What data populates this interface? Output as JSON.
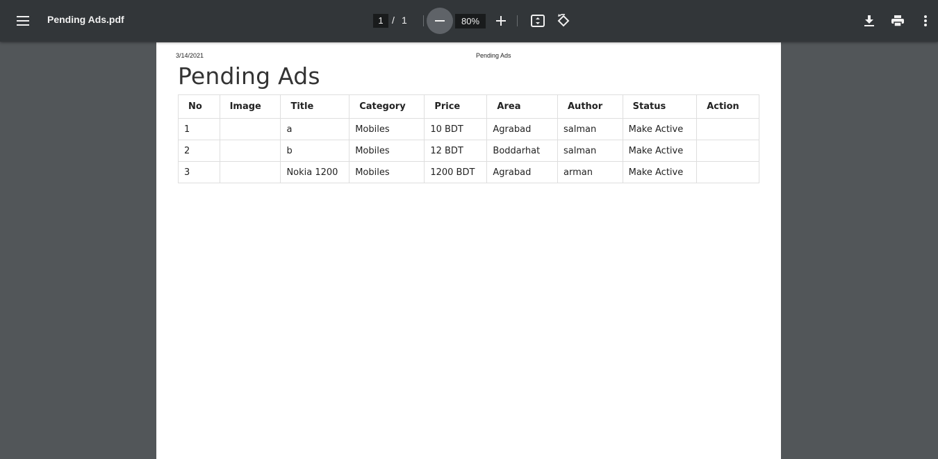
{
  "toolbar": {
    "file_name": "Pending Ads.pdf",
    "current_page": "1",
    "page_separator": "/",
    "total_pages": "1",
    "zoom": "80%",
    "icons": [
      "menu-icon",
      "zoom-out-icon",
      "zoom-in-icon",
      "fit-page-icon",
      "rotate-icon",
      "download-icon",
      "print-icon",
      "more-vert-icon"
    ]
  },
  "document": {
    "header_date": "3/14/2021",
    "header_title": "Pending Ads",
    "title": "Pending Ads",
    "table": {
      "headers": [
        "No",
        "Image",
        "Title",
        "Category",
        "Price",
        "Area",
        "Author",
        "Status",
        "Action"
      ],
      "rows": [
        [
          "1",
          "",
          "a",
          "Mobiles",
          "10 BDT",
          "Agrabad",
          "salman",
          "Make Active",
          ""
        ],
        [
          "2",
          "",
          "b",
          "Mobiles",
          "12 BDT",
          "Boddarhat",
          "salman",
          "Make Active",
          ""
        ],
        [
          "3",
          "",
          "Nokia 1200",
          "Mobiles",
          "1200 BDT",
          "Agrabad",
          "arman",
          "Make Active",
          ""
        ]
      ]
    }
  },
  "colors": {
    "toolbar_bg": "#323639",
    "viewer_bg": "#525659",
    "page_bg": "#ffffff"
  }
}
